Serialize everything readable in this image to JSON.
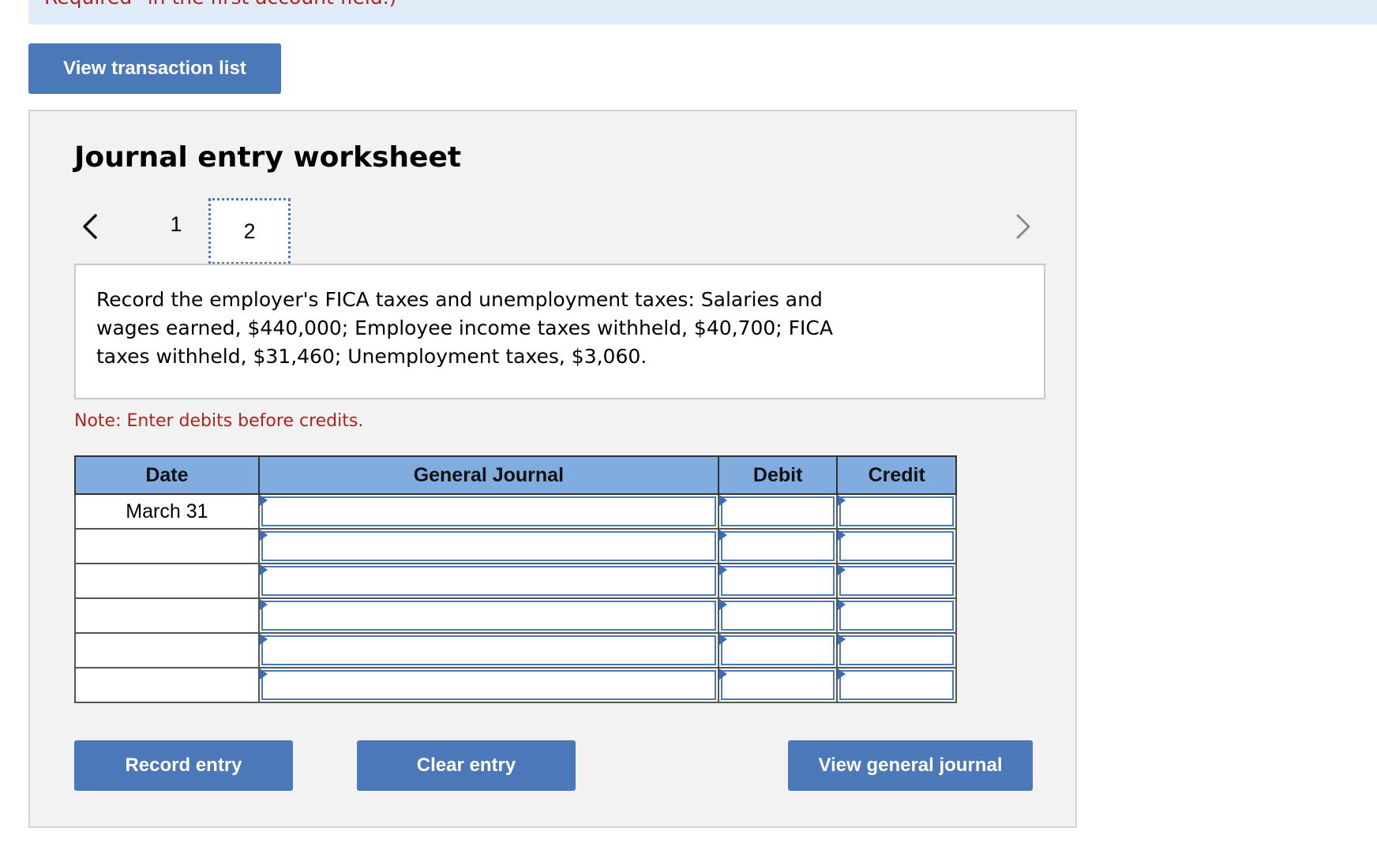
{
  "banner": {
    "text": "Required\" in the first account field.)"
  },
  "buttons": {
    "view_transaction_list": "View transaction list",
    "record_entry": "Record entry",
    "clear_entry": "Clear entry",
    "view_general_journal": "View general journal"
  },
  "worksheet": {
    "title": "Journal entry worksheet",
    "pages": [
      "1",
      "2"
    ],
    "active_page": "2",
    "prompt": "Record the employer's FICA taxes and unemployment taxes: Salaries and wages earned, $440,000; Employee income taxes withheld, $40,700; FICA taxes withheld, $31,460; Unemployment taxes, $3,060.",
    "note": "Note: Enter debits before credits."
  },
  "journal": {
    "headers": {
      "date": "Date",
      "general_journal": "General Journal",
      "debit": "Debit",
      "credit": "Credit"
    },
    "rows": [
      {
        "date": "March 31",
        "account": "",
        "debit": "",
        "credit": ""
      },
      {
        "date": "",
        "account": "",
        "debit": "",
        "credit": ""
      },
      {
        "date": "",
        "account": "",
        "debit": "",
        "credit": ""
      },
      {
        "date": "",
        "account": "",
        "debit": "",
        "credit": ""
      },
      {
        "date": "",
        "account": "",
        "debit": "",
        "credit": ""
      },
      {
        "date": "",
        "account": "",
        "debit": "",
        "credit": ""
      }
    ]
  },
  "icons": {
    "prev": "chevron-left-icon",
    "next": "chevron-right-icon",
    "entry_marker": "triangle-marker-icon"
  },
  "colors": {
    "button_bg": "#4a78b8",
    "header_bg": "#80ace0",
    "note_red": "#b02222",
    "worksheet_bg": "#f2f2f2",
    "banner_bg": "#e0ebf8"
  }
}
